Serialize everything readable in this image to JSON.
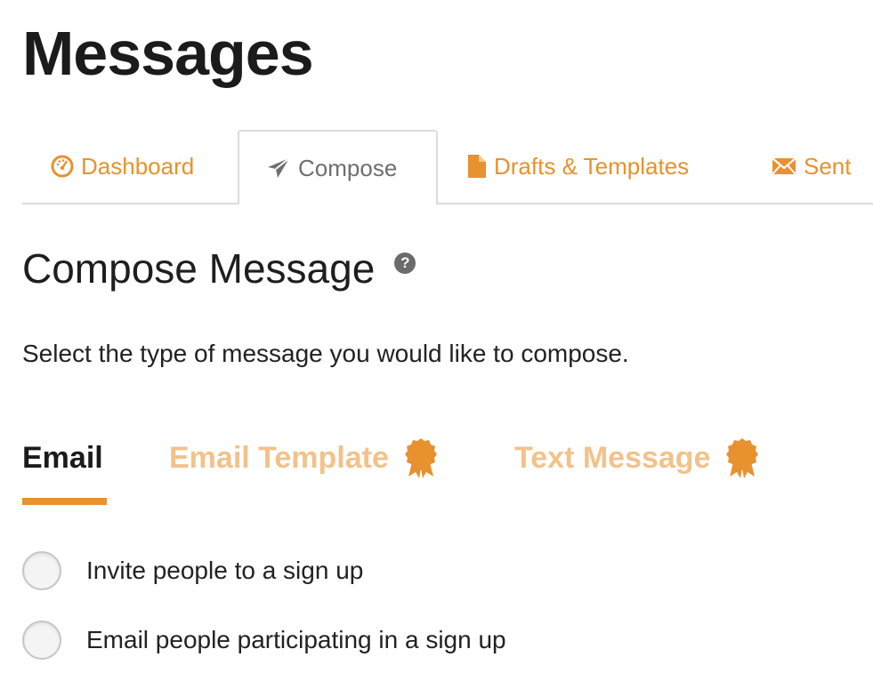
{
  "page": {
    "title": "Messages"
  },
  "nav_tabs": [
    {
      "label": "Dashboard",
      "icon": "dashboard-gauge-icon",
      "active": false
    },
    {
      "label": "Compose",
      "icon": "paper-plane-icon",
      "active": true
    },
    {
      "label": "Drafts & Templates",
      "icon": "document-icon",
      "active": false
    },
    {
      "label": "Sent",
      "icon": "envelope-icon",
      "active": false
    }
  ],
  "compose": {
    "heading": "Compose Message",
    "help_icon": "question-circle-icon",
    "instructions": "Select the type of message you would like to compose."
  },
  "message_types": [
    {
      "label": "Email",
      "active": true,
      "badge": null
    },
    {
      "label": "Email Template",
      "active": false,
      "badge": "premium-ribbon-icon"
    },
    {
      "label": "Text Message",
      "active": false,
      "badge": "premium-ribbon-icon"
    }
  ],
  "options": [
    {
      "label": "Invite people to a sign up",
      "selected": false
    },
    {
      "label": "Email people participating in a sign up",
      "selected": false
    }
  ],
  "colors": {
    "accent": "#e8912f",
    "accent_light": "#f2c28a",
    "tab_border": "#dcdcdc",
    "inactive_tab_text": "#6f6f6f"
  }
}
